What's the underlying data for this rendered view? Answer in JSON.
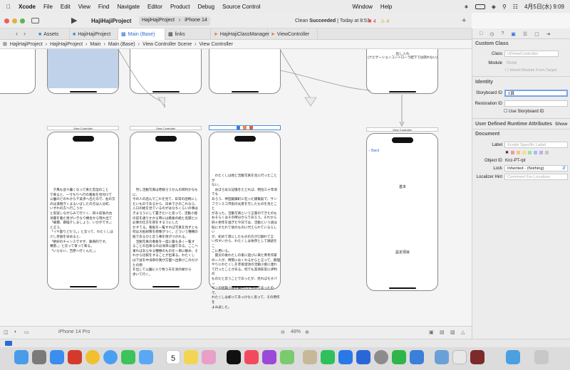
{
  "menubar": {
    "app": "Xcode",
    "items": [
      "File",
      "Edit",
      "View",
      "Find",
      "Navigate",
      "Editor",
      "Product",
      "Debug",
      "Source Control",
      "Window",
      "Help"
    ],
    "clock": "4月5日(水) 9:09"
  },
  "toolbar": {
    "project": "HajiHajiProject",
    "scheme": "HajiHajiProject",
    "device": "iPhone 14",
    "status_clean": "Clean",
    "status_result": "Succeeded",
    "status_time": "Today at 8:53",
    "errors": "4",
    "warnings": "4"
  },
  "tabs": [
    "Assets",
    "HajiHajiProject",
    "Main (Base)",
    "links",
    "HajiHajiClassManager",
    "ViewController"
  ],
  "jumpbar": [
    "HajiHajiProject",
    "HajiHajiProject",
    "Main",
    "Main (Base)",
    "View Controller Scene",
    "View Controller"
  ],
  "canvas": {
    "nav_note_top": "出し入れ",
    "nav_note": "(ナビゲーションコントローラ配下では隠れない)",
    "scene_title": "View Controller",
    "text1": "　夕風も追々暮くなって来た宮廷のこと\nで来ると、一寸ちりへ行の看板を見付けて\n公園のどのれからテ美歩へ出たので、右の方\nのは道側きくまるいばしたの方は入分町、\nいずれの方へ行こうか\nと思案しながらみて行ぐく、四十前後の古\n洋服を着た男がいきなり横合から現れ出て\n「確都、御経介しましょう、いかがです。」\nと言う。\n「イヤ妻りどだう。」と云って、わたくしは\n少し歩調を早めると、\n「絶好のチャンスですぜ、猟奇的です。\n横割、」と云って寄って来る。\n「いらない、吉原へ行くんだ。」",
    "text2": "　然し活動写真は老眼ろうかんの目利かなもに、\n今の人の話んでこれを見て、日常の話柄にし\nたいものであるから、日本でさのこれなら、\n入口の絵を見ているのがはなちくらいの事は\nきまろうにして置きたいと思って、活動小屋\nの前を通りかかる時には看板の絵と名題とに\n必要の仕方を目をするうにした\nかすてる。看板を一覧すれば写真を見ずとも\n何は大抵想像を想像がつく。どういう種類の\n筋であるかと云う事を目がつかれる。\n　活動写真の看板を一度に最も多く一覧す\nることの出来るのは浅草公園である。ここへ\n来ればあらゆる種類のものを一目に眺め、そ\nれから比較をすることが出来る。わたくし\nは下谷を中浅草の我が方面へ出掛けこのだけ\nたの例\nを出して公園に入り牧う天を池の緑から\n歩いて行く。",
    "text3": "　わたくしは殆ど活動写真を見に行ったことが\nない。\n　おぼろ気な記憶をたどれば、明治三十年頃でも\nあろう、神田鍛錬町に在った錦集館で、サン\nフランスコ市街の光景を写したものを見たこと\nがあった。活動写真という言葉のできたのも\nおそらくはその時分からであろう。それから\n四十余年を過ぎた今日では、活動という語は\n既にすたれて他のものに代えられているらしい\nが、初めて耳にしたものの方が口馴れて言\nい作すいから、わたくしは依然として廃語をこ\nこに用いる。\n　震災の後わたしの家に遊びに来た青年作家\nの一人が、時勢におくれるからと言って、無理\nやりにわたくしを赤坂溜池の活動小屋に連れ\nて行ったことがある。何でも其頃非常に評判の\nものだと云うことであったが、見ればモオパッ\nサンの短篇小説を脚色したものであったので、\nわたくしは却ってあっけなく思って、その原作を\nよみ返した。",
    "label_main": "基本",
    "label_settings": "設定項目",
    "back": "Back"
  },
  "bottombar": {
    "device": "iPhone 14 Pro",
    "zoom": "48%"
  },
  "inspector": {
    "custom_class": "Custom Class",
    "class_label": "Class",
    "class_placeholder": "UIViewController",
    "module_label": "Module",
    "module_value": "None",
    "inherit": "Inherit Module From Target",
    "identity": "Identity",
    "sb_id_label": "Storyboard ID",
    "sb_id_value": "1頁",
    "restoration_label": "Restoration ID",
    "use_sb": "Use Storyboard ID",
    "udra": "User Defined Runtime Attributes",
    "show": "Show",
    "document": "Document",
    "label_label": "Label",
    "label_placeholder": "Xcode Specific Label",
    "objid_label": "Object ID",
    "objid_value": "Knz-PT-rpt",
    "lock_label": "Lock",
    "lock_value": "Inherited - (Nothing)",
    "loc_label": "Localizer Hint",
    "loc_placeholder": "Comment For Localizer"
  },
  "dock_calendar": "5"
}
